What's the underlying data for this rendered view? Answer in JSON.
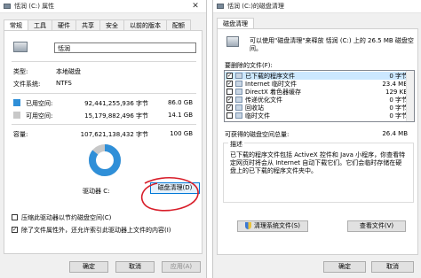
{
  "left_window": {
    "title": "恬润 (C:) 属性",
    "tabs": [
      "常规",
      "工具",
      "硬件",
      "共享",
      "安全",
      "以前的版本",
      "配额"
    ],
    "drive_name_value": "恬润",
    "type_label": "类型:",
    "type_value": "本地磁盘",
    "fs_label": "文件系统:",
    "fs_value": "NTFS",
    "used_label": "已用空间:",
    "used_bytes": "92,441,255,936 字节",
    "used_size": "86.0 GB",
    "free_label": "可用空间:",
    "free_bytes": "15,179,882,496 字节",
    "free_size": "14.1 GB",
    "capacity_label": "容量:",
    "capacity_bytes": "107,621,138,432 字节",
    "capacity_size": "100 GB",
    "used_fraction": 0.859,
    "drive_caption": "驱动器 C:",
    "cleanup_button": "磁盘清理(D)",
    "compress_label": "压缩此驱动器以节约磁盘空间(C)",
    "index_label": "除了文件属性外，还允许索引此驱动器上文件的内容(I)",
    "ok": "确定",
    "cancel": "取消",
    "apply": "应用(A)",
    "colors": {
      "used": "#2f8fd8",
      "free": "#c8c8c8",
      "annotation": "#d81e2a"
    }
  },
  "right_window": {
    "title": "恬润 (C:)的磁盘清理",
    "tab": "磁盘清理",
    "intro": "可以使用\"磁盘清理\"来释放 恬润 (C:) 上的 26.5 MB 磁盘空间。",
    "files_label": "要删除的文件(F):",
    "files": [
      {
        "label": "已下载的程序文件",
        "size": "0 字节",
        "checked": true,
        "selected": true
      },
      {
        "label": "Internet 临时文件",
        "size": "23.4 MB",
        "checked": true,
        "selected": false
      },
      {
        "label": "DirectX 着色器缓存",
        "size": "129 KB",
        "checked": false,
        "selected": false
      },
      {
        "label": "传递优化文件",
        "size": "0 字节",
        "checked": true,
        "selected": false
      },
      {
        "label": "回收站",
        "size": "0 字节",
        "checked": true,
        "selected": false
      },
      {
        "label": "临时文件",
        "size": "0 字节",
        "checked": false,
        "selected": false
      }
    ],
    "total_label": "可获得的磁盘空间总量:",
    "total_value": "26.4 MB",
    "desc_title": "描述",
    "desc_text": "已下载的程序文件包括 ActiveX 控件和 Java 小程序，你查看特定网页时将会从 Internet 自动下载它们。它们会临时存储在硬盘上的已下载的程序文件夹中。",
    "clean_sys_button": "清理系统文件(S)",
    "view_files_button": "查看文件(V)",
    "ok": "确定",
    "cancel": "取消"
  }
}
